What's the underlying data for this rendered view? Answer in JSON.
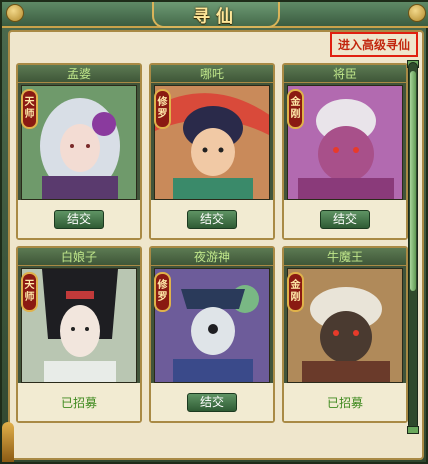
{
  "window": {
    "title": "寻仙"
  },
  "header": {
    "advanced_link": "进入高级寻仙"
  },
  "cards": [
    {
      "name": "孟婆",
      "badge": [
        "天",
        "师"
      ],
      "status": "button",
      "label": "结交",
      "theme": "#9fa9b6"
    },
    {
      "name": "哪吒",
      "badge": [
        "修",
        "罗"
      ],
      "status": "button",
      "label": "结交",
      "theme": "#c3734a"
    },
    {
      "name": "将臣",
      "badge": [
        "金",
        "刚"
      ],
      "status": "button",
      "label": "结交",
      "theme": "#a05a9e"
    },
    {
      "name": "白娘子",
      "badge": [
        "天",
        "师"
      ],
      "status": "recruited",
      "label": "已招募",
      "theme": "#c9d3c4"
    },
    {
      "name": "夜游神",
      "badge": [
        "修",
        "罗"
      ],
      "status": "button",
      "label": "结交",
      "theme": "#7b6aa8"
    },
    {
      "name": "牛魔王",
      "badge": [
        "金",
        "刚"
      ],
      "status": "recruited",
      "label": "已招募",
      "theme": "#8e6a45"
    }
  ],
  "colors": {
    "accent_red": "#e02010",
    "button_green": "#2f5b34",
    "recruited_green": "#3f8a1f"
  },
  "icons": {
    "scroll": "scrollbar",
    "close": "corner-ornament"
  }
}
